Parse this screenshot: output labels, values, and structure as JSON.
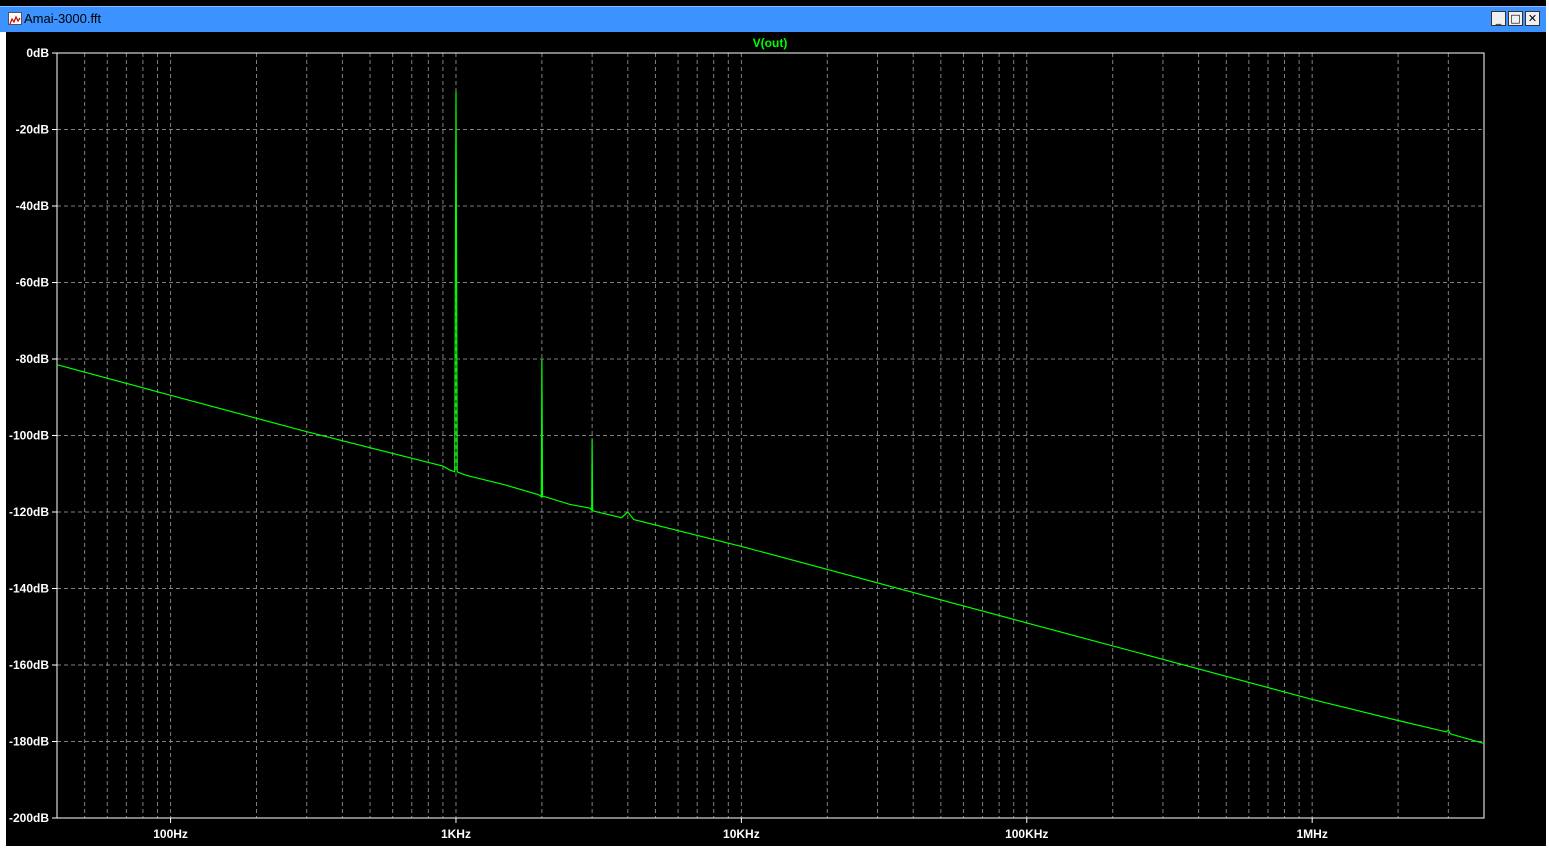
{
  "window": {
    "title": "Amai-3000.fft",
    "minimize_glyph": "_",
    "maximize_glyph": "□",
    "close_glyph": "✕",
    "icon": "waveform-icon"
  },
  "colors": {
    "background": "#000000",
    "trace": "#00ff00",
    "grid": "#808080",
    "axis_text": "#ffffff",
    "titlebar": "#3c93ff"
  },
  "chart_data": {
    "type": "line",
    "title": "V(out)",
    "xscale": "log",
    "xlim": [
      40,
      4000000
    ],
    "ylim": [
      -200,
      0
    ],
    "grid": true,
    "xticks": [
      {
        "value": 100,
        "label": "100Hz"
      },
      {
        "value": 1000,
        "label": "1KHz"
      },
      {
        "value": 10000,
        "label": "10KHz"
      },
      {
        "value": 100000,
        "label": "100KHz"
      },
      {
        "value": 1000000,
        "label": "1MHz"
      }
    ],
    "yticks": [
      {
        "value": 0,
        "label": "0dB"
      },
      {
        "value": -20,
        "label": "-20dB"
      },
      {
        "value": -40,
        "label": "-40dB"
      },
      {
        "value": -60,
        "label": "-60dB"
      },
      {
        "value": -80,
        "label": "-80dB"
      },
      {
        "value": -100,
        "label": "-100dB"
      },
      {
        "value": -120,
        "label": "-120dB"
      },
      {
        "value": -140,
        "label": "-140dB"
      },
      {
        "value": -160,
        "label": "-160dB"
      },
      {
        "value": -180,
        "label": "-180dB"
      },
      {
        "value": -200,
        "label": "-200dB"
      }
    ],
    "series": [
      {
        "name": "V(out)",
        "x": [
          40,
          100,
          300,
          900,
          950,
          990,
          1000,
          1010,
          1050,
          1100,
          1500,
          1950,
          1990,
          2000,
          2010,
          2050,
          2500,
          2950,
          2990,
          3000,
          3010,
          3050,
          3800,
          4000,
          4200,
          10000,
          100000,
          1000000,
          2000000,
          2950000,
          3000000,
          3050000,
          4000000
        ],
        "y": [
          -81.5,
          -89.5,
          -99,
          -108,
          -109,
          -109.5,
          -10,
          -109.5,
          -110,
          -110.5,
          -113,
          -115.5,
          -116,
          -80,
          -116,
          -116,
          -118,
          -119,
          -119.5,
          -101,
          -119.5,
          -119.8,
          -121.5,
          -120,
          -122,
          -129,
          -149,
          -169,
          -174.5,
          -177.5,
          -177,
          -178,
          -180.5
        ]
      }
    ]
  }
}
